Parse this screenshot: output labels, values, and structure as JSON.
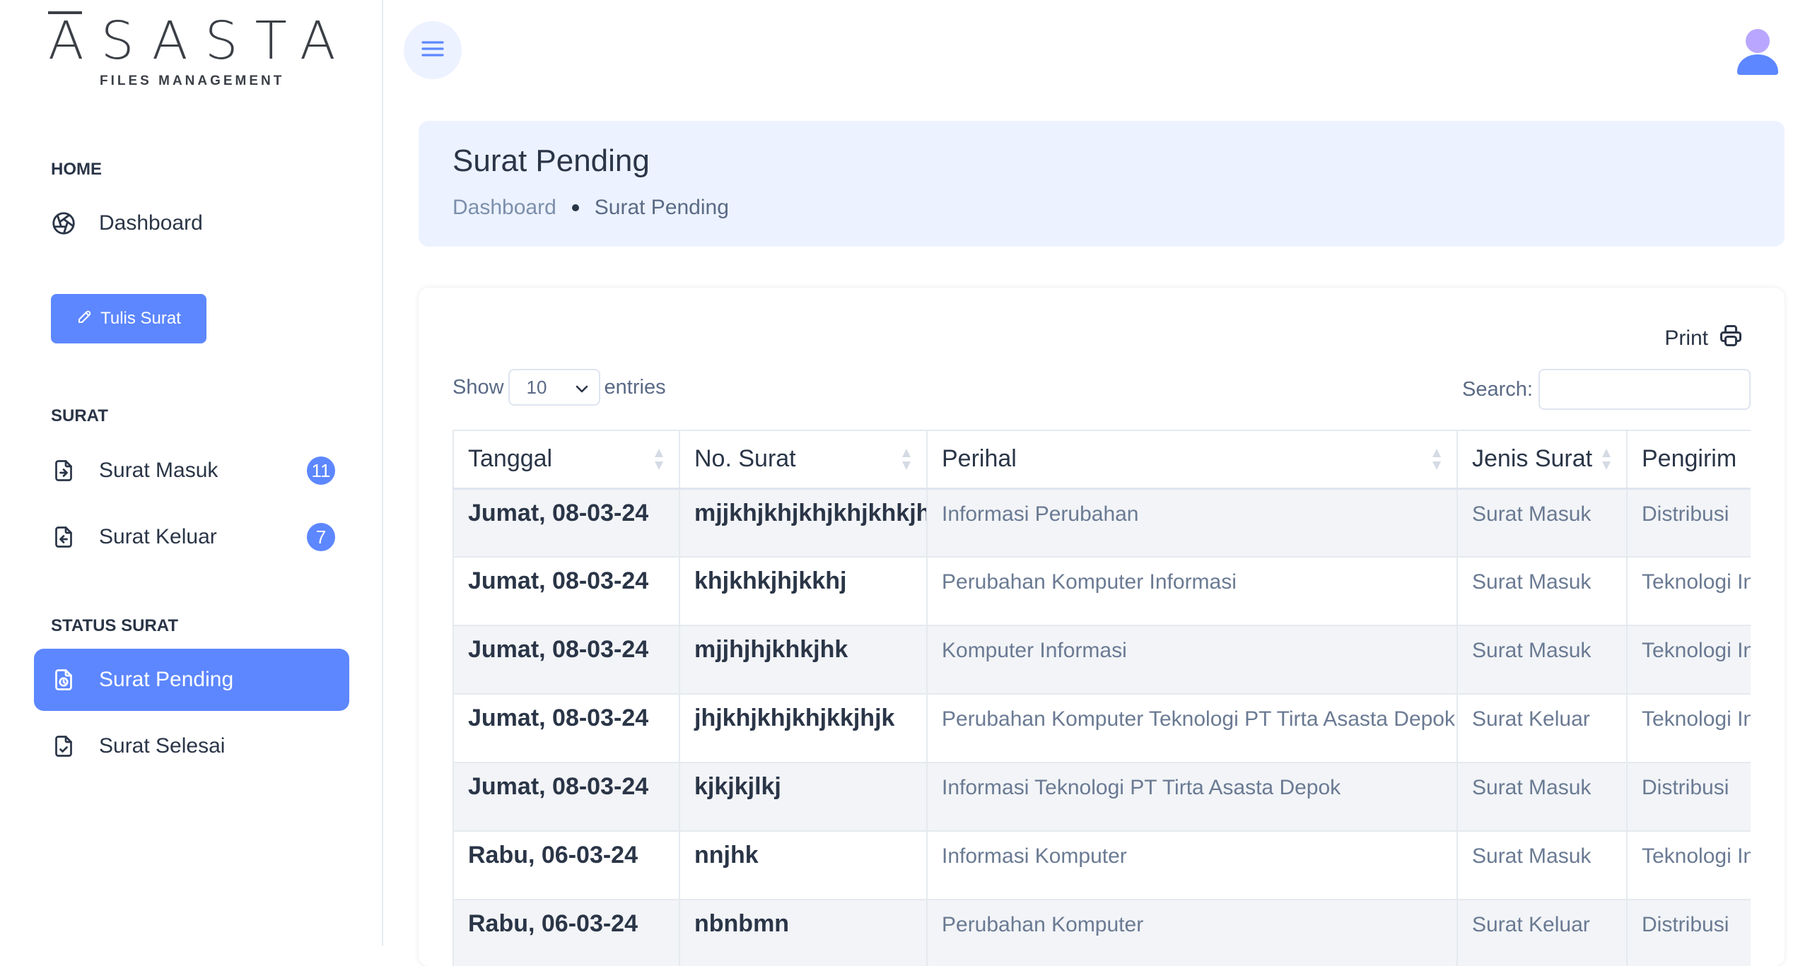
{
  "brand": {
    "name": "ASASTA",
    "subtitle": "FILES MANAGEMENT"
  },
  "sidebar": {
    "sections": [
      {
        "caption": "HOME"
      },
      {
        "caption": "SURAT"
      },
      {
        "caption": "STATUS SURAT"
      }
    ],
    "dashboard": {
      "label": "Dashboard",
      "icon": "aperture-icon"
    },
    "write_button": {
      "label": "Tulis Surat",
      "icon": "pencil-icon"
    },
    "surat_masuk": {
      "label": "Surat Masuk",
      "count": "11",
      "icon": "file-import-icon"
    },
    "surat_keluar": {
      "label": "Surat Keluar",
      "count": "7",
      "icon": "file-export-icon"
    },
    "surat_pending": {
      "label": "Surat Pending",
      "icon": "file-clock-icon",
      "active": true
    },
    "surat_selesai": {
      "label": "Surat Selesai",
      "icon": "file-check-icon"
    }
  },
  "header": {
    "menu_icon": "hamburger-icon",
    "avatar_icon": "user-avatar-icon"
  },
  "page": {
    "title": "Surat Pending",
    "breadcrumb": {
      "parent": "Dashboard",
      "current": "Surat Pending"
    }
  },
  "table_controls": {
    "print_label": "Print",
    "show_label": "Show",
    "entries_value": "10",
    "entries_label": "entries",
    "search_label": "Search:",
    "search_value": ""
  },
  "table": {
    "columns": [
      "Tanggal",
      "No. Surat",
      "Perihal",
      "Jenis Surat",
      "Pengirim"
    ],
    "rows": [
      [
        "Jumat, 08-03-24",
        "mjjkhjkhjkhjkhjkhkjh",
        "Informasi Perubahan",
        "Surat Masuk",
        "Distribusi"
      ],
      [
        "Jumat, 08-03-24",
        "khjkhkjhjkkhj",
        "Perubahan Komputer Informasi",
        "Surat Masuk",
        "Teknologi In"
      ],
      [
        "Jumat, 08-03-24",
        "mjjhjhjkhkjhk",
        "Komputer Informasi",
        "Surat Masuk",
        "Teknologi In"
      ],
      [
        "Jumat, 08-03-24",
        "jhjkhjkhjkhjkkjhjk",
        "Perubahan Komputer Teknologi PT Tirta Asasta Depok",
        "Surat Keluar",
        "Teknologi In"
      ],
      [
        "Jumat, 08-03-24",
        "kjkjkjlkj",
        "Informasi Teknologi PT Tirta Asasta Depok",
        "Surat Masuk",
        "Distribusi"
      ],
      [
        "Rabu, 06-03-24",
        "nnjhk",
        "Informasi Komputer",
        "Surat Masuk",
        "Teknologi In"
      ],
      [
        "Rabu, 06-03-24",
        "nbnbmn",
        "Perubahan Komputer",
        "Surat Keluar",
        "Distribusi"
      ]
    ]
  },
  "colors": {
    "primary": "#5d87ff",
    "primary_light": "#ecf2ff",
    "text_dark": "#2a3547",
    "text_muted": "#5a6a85"
  }
}
